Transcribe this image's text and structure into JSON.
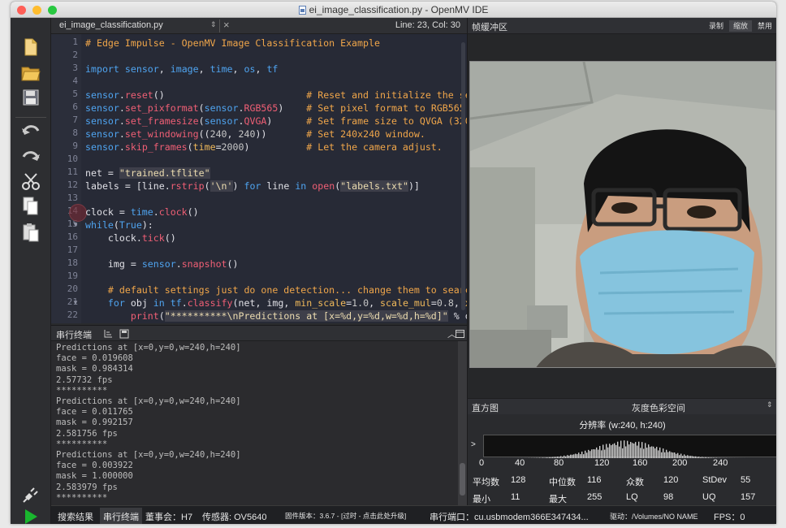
{
  "window": {
    "title": "ei_image_classification.py - OpenMV IDE",
    "lights": [
      "#ff5f57",
      "#febc2e",
      "#28c840"
    ]
  },
  "toolbar": {
    "icons": [
      "new-file-icon",
      "open-folder-icon",
      "save-icon",
      "undo-icon",
      "redo-icon",
      "cut-icon",
      "copy-icon",
      "paste-icon"
    ],
    "bottom_icons": [
      "connect-icon",
      "run-icon"
    ]
  },
  "editor": {
    "file_tab": "ei_image_classification.py",
    "tab_arrows": "⇕",
    "close": "×",
    "line_col": "Line: 23, Col: 30",
    "line_numbers": [
      "1",
      "2",
      "3",
      "4",
      "5",
      "6",
      "7",
      "8",
      "9",
      "10",
      "11",
      "12",
      "13",
      "14",
      "15",
      "16",
      "17",
      "18",
      "19",
      "20",
      "21",
      "22"
    ],
    "folds": {
      "15": "▼",
      "21": "▼"
    }
  },
  "terminal": {
    "title": "串行终端",
    "lines": [
      "Predictions at [x=0,y=0,w=240,h=240]",
      "face = 0.019608",
      "mask = 0.984314",
      "2.57732 fps",
      "**********",
      "Predictions at [x=0,y=0,w=240,h=240]",
      "face = 0.011765",
      "mask = 0.992157",
      "2.581756 fps",
      "**********",
      "Predictions at [x=0,y=0,w=240,h=240]",
      "face = 0.003922",
      "mask = 1.000000",
      "2.583979 fps",
      "**********"
    ]
  },
  "framebuffer": {
    "title": "帧缓冲区",
    "buttons": [
      "录制",
      "缩放",
      "禁用"
    ]
  },
  "histogram": {
    "title": "直方图",
    "colorspace": "灰度色彩空间",
    "resolution": "分辨率 (w:240, h:240)",
    "ticks": [
      "0",
      "40",
      "80",
      "120",
      "160",
      "200",
      "240"
    ],
    "stats": {
      "mean_label": "平均数",
      "mean": "128",
      "median_label": "中位数",
      "median": "116",
      "mode_label": "众数",
      "mode": "120",
      "stdev_label": "StDev",
      "stdev": "55",
      "min_label": "最小",
      "min": "11",
      "max_label": "最大",
      "max": "255",
      "lq_label": "LQ",
      "lq": "98",
      "uq_label": "UQ",
      "uq": "157"
    }
  },
  "statusbar": {
    "search": "搜索结果",
    "serial": "串行终端",
    "board": "董事会：H7",
    "sensor": "传感器: OV5640",
    "firmware": "固件版本：3.6.7 - [过时 - 点击此处升级]",
    "port": "串行端口：cu.usbmodem366E347434...",
    "drive": "驱动：/Volumes/NO NAME",
    "fps": "FPS：0"
  }
}
